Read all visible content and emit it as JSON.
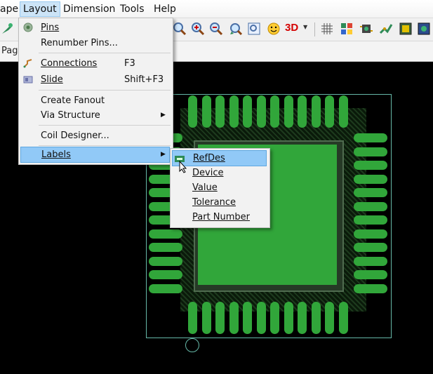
{
  "menubar": {
    "items": [
      {
        "label": "ape"
      },
      {
        "label": "Layout"
      },
      {
        "label": "Dimension"
      },
      {
        "label": "Tools"
      },
      {
        "label": "Help"
      }
    ]
  },
  "tabstrip": {
    "label": "Pag"
  },
  "layout_menu": {
    "items": [
      {
        "label": "Pins",
        "icon": "pins-icon"
      },
      {
        "label": "Renumber Pins..."
      },
      {
        "label": "Connections",
        "shortcut": "F3",
        "icon": "connections-icon"
      },
      {
        "label": "Slide",
        "shortcut": "Shift+F3",
        "icon": "slide-icon"
      },
      {
        "label": "Create Fanout"
      },
      {
        "label": "Via Structure",
        "arrow": "▶"
      },
      {
        "label": "Coil Designer..."
      },
      {
        "label": "Labels",
        "arrow": "▶"
      }
    ]
  },
  "labels_submenu": {
    "items": [
      {
        "label": "RefDes",
        "icon": "refdes-icon"
      },
      {
        "label": "Device"
      },
      {
        "label": "Value"
      },
      {
        "label": "Tolerance"
      },
      {
        "label": "Part Number"
      }
    ]
  },
  "toolbar": {
    "toolbar_label_3d": "3D",
    "icons": [
      "pin-tool-icon",
      "zoom-in-icon",
      "zoom-in-alt-icon",
      "zoom-out-icon",
      "zoom-previous-icon",
      "zoom-fit-icon",
      "smiley-icon",
      "3d-view-icon",
      "grid-icon",
      "layers-icon",
      "component-icon",
      "route-icon",
      "board-icon",
      "drc-icon"
    ]
  },
  "colors": {
    "copper": "#31a63a",
    "board_outline": "#66b8a8",
    "menu_highlight": "#91c9f7",
    "canvas": "#000000"
  }
}
